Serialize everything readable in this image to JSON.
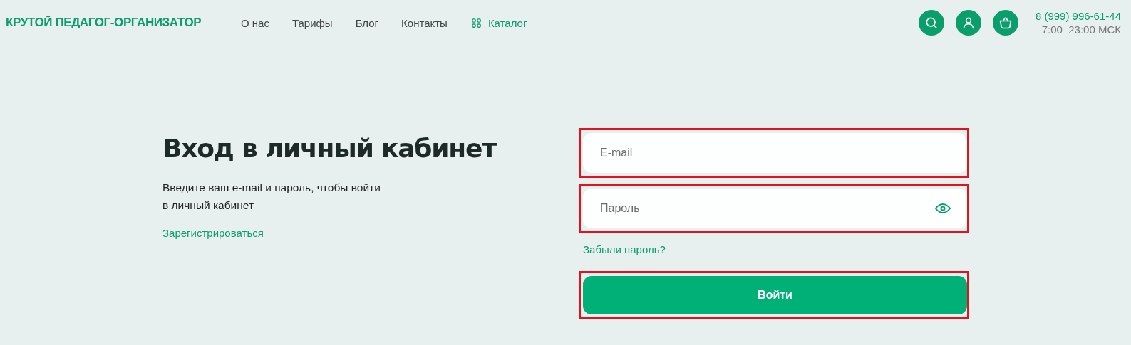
{
  "header": {
    "logo": "КРУТОЙ ПЕДАГОГ-ОРГАНИЗАТОР",
    "nav": [
      {
        "label": "О нас",
        "kind": "link"
      },
      {
        "label": "Тарифы",
        "kind": "link"
      },
      {
        "label": "Блог",
        "kind": "link"
      },
      {
        "label": "Контакты",
        "kind": "link"
      },
      {
        "label": "Каталог",
        "kind": "catalog"
      }
    ],
    "actions": [
      {
        "kind": "search"
      },
      {
        "kind": "user"
      },
      {
        "kind": "cart"
      }
    ],
    "phone": "8 (999) 996-61-44",
    "hours": "7:00–23:00 МСК"
  },
  "intro": {
    "title": "Вход в личный кабинет",
    "text": "Введите ваш e-mail и пароль, чтобы войти в личный кабинет",
    "register_link": "Зарегистрироваться"
  },
  "form": {
    "fields": [
      {
        "kind": "email",
        "placeholder": "E-mail",
        "highlighted": true
      },
      {
        "kind": "password",
        "placeholder": "Пароль",
        "highlighted": true
      }
    ],
    "forgot_link": "Забыли пароль?",
    "submit": {
      "label": "Войти",
      "highlighted": true
    }
  }
}
